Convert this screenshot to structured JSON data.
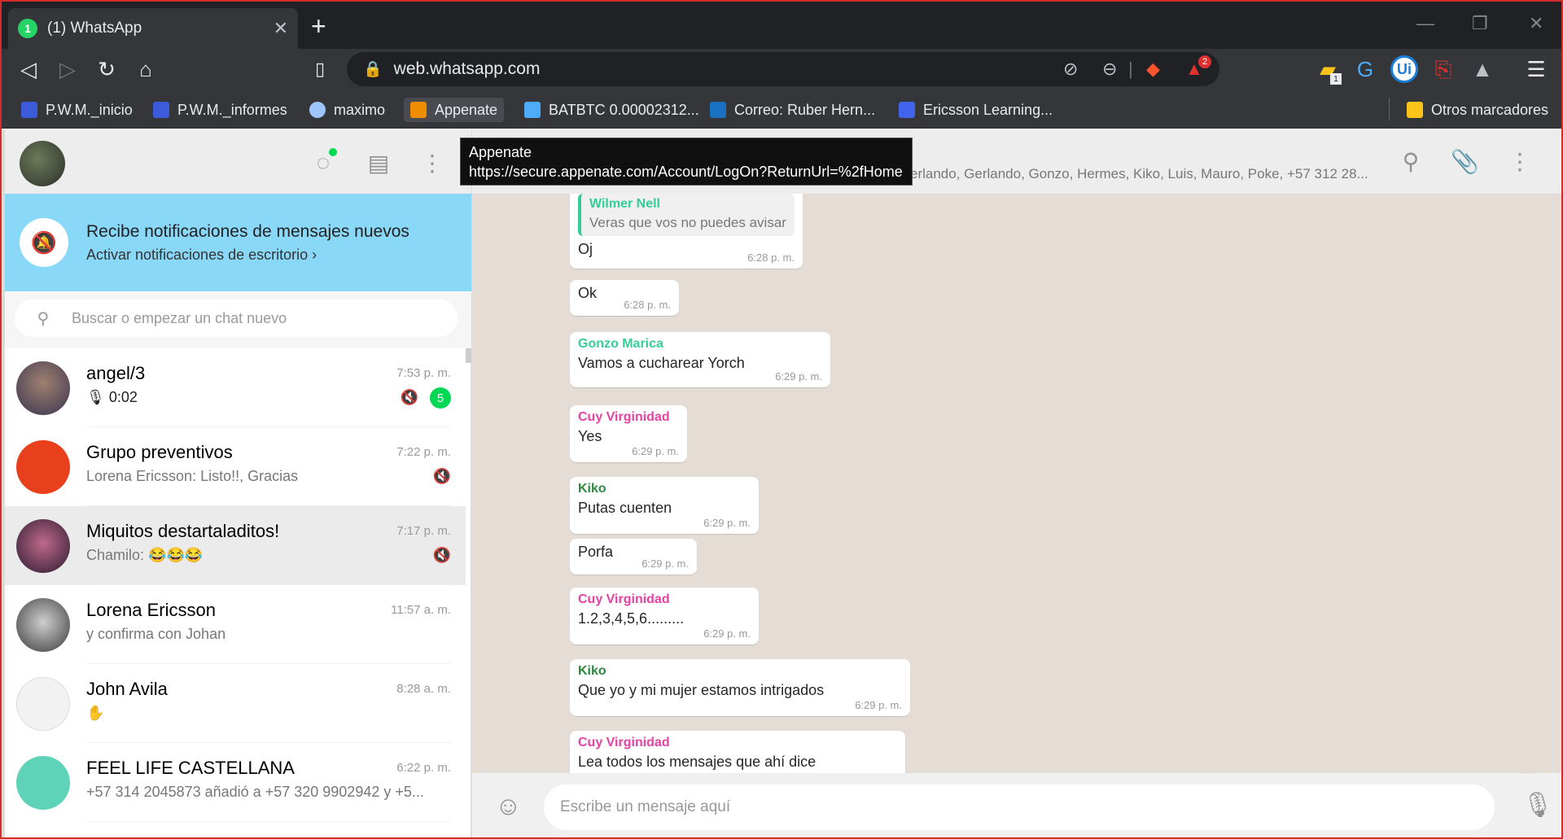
{
  "browser": {
    "tab_title": "(1) WhatsApp",
    "tab_badge": "1",
    "url": "web.whatsapp.com",
    "bookmarks": [
      {
        "label": "P.W.M._inicio",
        "color": "#3b5bdb"
      },
      {
        "label": "P.W.M._informes",
        "color": "#3b5bdb"
      },
      {
        "label": "maximo",
        "color": "#9ec5fe"
      },
      {
        "label": "Appenate",
        "color": "#f08c00"
      },
      {
        "label": "BATBTC 0.00002312...",
        "color": "#4dabf7"
      },
      {
        "label": "Correo: Ruber Hern...",
        "color": "#1971c2"
      },
      {
        "label": "Ericsson Learning...",
        "color": "#4263eb"
      }
    ],
    "other_bookmarks": "Otros marcadores",
    "alert_badge": "2",
    "ext_badge": "1",
    "ext_ui_label": "Ui"
  },
  "tooltip": {
    "title": "Appenate",
    "url": "https://secure.appenate.com/Account/LogOn?ReturnUrl=%2fHome"
  },
  "notification": {
    "title": "Recibe notificaciones de mensajes nuevos",
    "link": "Activar notificaciones de escritorio ›"
  },
  "search": {
    "placeholder": "Buscar o empezar un chat nuevo"
  },
  "chats": [
    {
      "name": "angel/3",
      "time": "7:53 p. m.",
      "msg": "🎙 0:02",
      "unread": "5",
      "avatar": "#7b5e57"
    },
    {
      "name": "Grupo preventivos",
      "time": "7:22 p. m.",
      "msg": "Lorena Ericsson: Listo!!, Gracias",
      "avatar": "#e8401c"
    },
    {
      "name": "Miquitos destartaladitos!",
      "time": "7:17 p. m.",
      "msg": "Chamilo: 😂😂😂",
      "avatar": "#6a2b4c"
    },
    {
      "name": "Lorena Ericsson",
      "time": "11:57 a. m.",
      "msg": "y confirma con Johan",
      "avatar": "#8a8a8a"
    },
    {
      "name": "John Avila",
      "time": "8:28 a. m.",
      "msg": "✋",
      "avatar": "#f2f2f2"
    },
    {
      "name": "FEEL LIFE CASTELLANA",
      "time": "6:22 p. m.",
      "msg": "+57 314 2045873 añadió a +57 320 9902942 y +5...",
      "avatar": "#5fd3b8"
    }
  ],
  "chat_header": {
    "members": "erlando, Gerlando, Gonzo, Hermes, Kiko, Luis, Mauro, Poke, +57 312 28..."
  },
  "messages": {
    "m1": {
      "quote_author": "Wilmer Nell",
      "quote_text": "Veras que vos no puedes avisar",
      "text": "Oj",
      "time": "6:28 p. m."
    },
    "m2": {
      "text": "Ok",
      "time": "6:28 p. m."
    },
    "m3": {
      "author": "Gonzo Marica",
      "text": "Vamos a cucharear Yorch",
      "time": "6:29 p. m."
    },
    "m4": {
      "author": "Cuy Virginidad",
      "text": "Yes",
      "time": "6:29 p. m."
    },
    "m5": {
      "author": "Kiko",
      "text": "Putas cuenten",
      "time": "6:29 p. m."
    },
    "m6": {
      "text": "Porfa",
      "time": "6:29 p. m."
    },
    "m7": {
      "author": "Cuy Virginidad",
      "text": "1.2,3,4,5,6.........",
      "time": "6:29 p. m."
    },
    "m8": {
      "author": "Kiko",
      "text": "Que yo y mi mujer estamos intrigados",
      "time": "6:29 p. m."
    },
    "m9": {
      "author": "Cuy Virginidad",
      "text": "Lea todos los mensajes que ahí dice",
      "time": ""
    }
  },
  "author_colors": {
    "gonzo": "#35cd96",
    "cuy": "#e542a3",
    "kiko": "#1f7aec"
  },
  "composer": {
    "placeholder": "Escribe un mensaje aquí"
  }
}
